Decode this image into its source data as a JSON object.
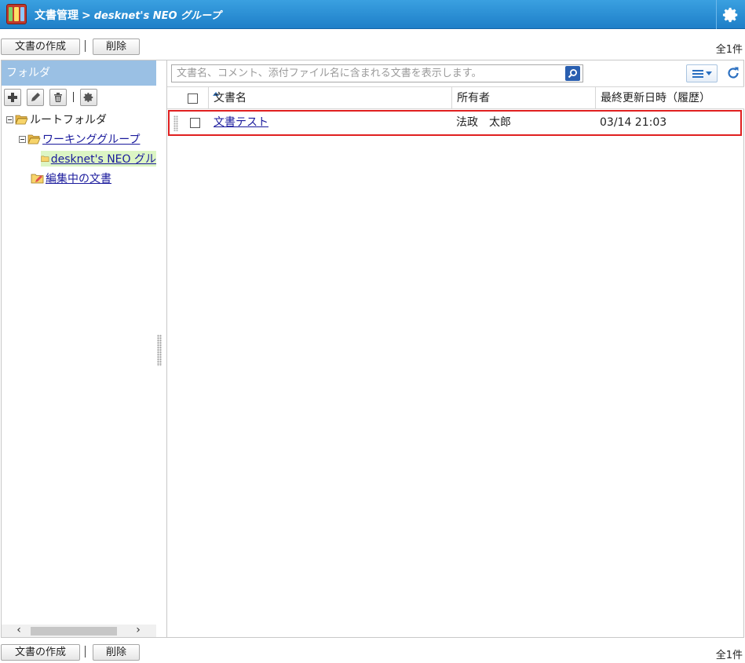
{
  "header": {
    "app_name": "文書管理",
    "separator": ">",
    "group_name": "desknet's NEO グループ"
  },
  "toolbar": {
    "create_label": "文書の作成",
    "delete_label": "削除",
    "count": "全1件"
  },
  "folder_panel": {
    "title": "フォルダ",
    "tree": {
      "root": "ルートフォルダ",
      "working_group": "ワーキンググループ",
      "selected_folder": "desknet's NEO グル",
      "editing": "編集中の文書"
    }
  },
  "search": {
    "placeholder": "文書名、コメント、添付ファイル名に含まれる文書を表示します。"
  },
  "table": {
    "columns": [
      "文書名",
      "所有者",
      "最終更新日時（履歴）"
    ],
    "rows": [
      {
        "name": "文書テスト",
        "owner": "法政　太郎",
        "updated": "03/14 21:03"
      }
    ]
  },
  "colors": {
    "header_blue": "#1e7fc8",
    "folder_head": "#9ac0e4",
    "selected_bg": "#dcf5c4",
    "highlight_border": "#e02020"
  }
}
